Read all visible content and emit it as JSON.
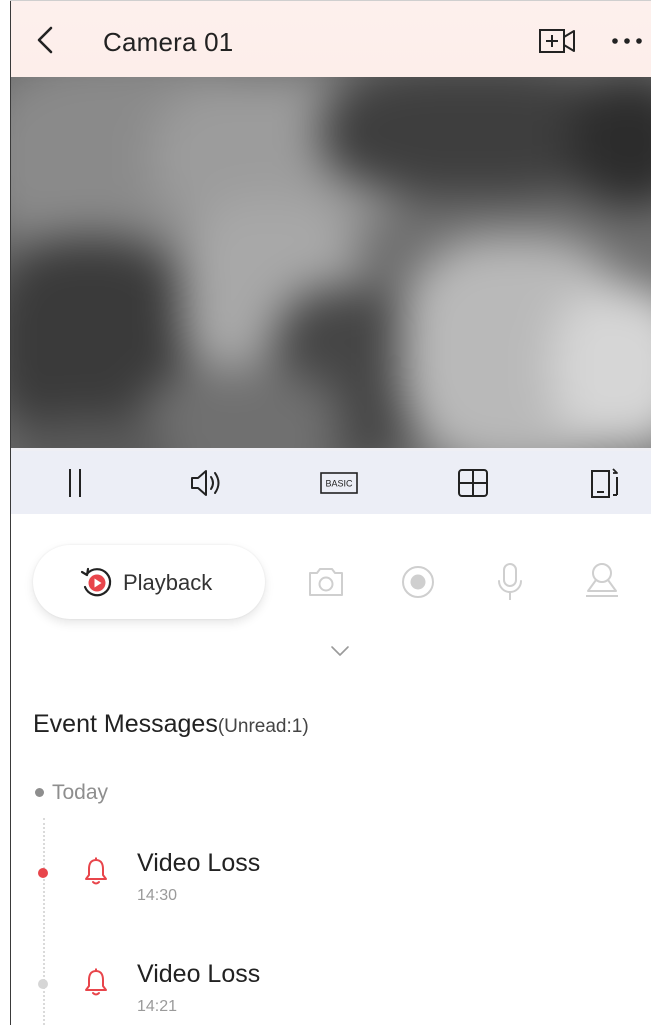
{
  "header": {
    "title": "Camera 01",
    "back_icon": "chevron-left-icon",
    "add_camera_icon": "add-camera-icon",
    "more_icon": "more-dots-icon"
  },
  "video": {
    "state": "blurred live view"
  },
  "controls": {
    "pause_icon": "pause-icon",
    "volume_icon": "speaker-icon",
    "quality_label": "BASIC",
    "layout_icon": "grid-icon",
    "fullscreen_icon": "rotate-screen-icon",
    "background": "#eceef6"
  },
  "actions": {
    "playback_label": "Playback",
    "playback_icon": "playback-icon",
    "snapshot_icon": "camera-icon",
    "record_icon": "record-icon",
    "talk_icon": "microphone-icon",
    "ptz_icon": "ptz-icon",
    "expand_icon": "chevron-down-icon"
  },
  "events": {
    "heading": "Event Messages",
    "unread": "(Unread:1)",
    "group_label": "Today",
    "items": [
      {
        "title": "Video Loss",
        "time": "14:30",
        "unread": true
      },
      {
        "title": "Video Loss",
        "time": "14:21",
        "unread": false
      }
    ]
  },
  "colors": {
    "accent": "#e8454b",
    "header_bg": "#fdeeea",
    "muted": "#8e8e8e",
    "disabled_icon": "#d0d0d0"
  }
}
